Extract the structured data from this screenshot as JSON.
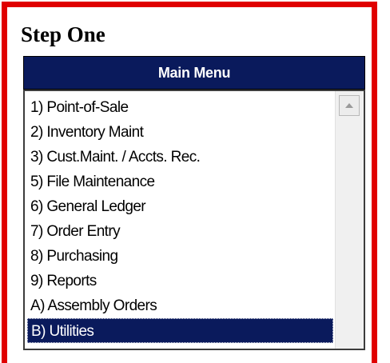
{
  "step_title": "Step One",
  "main_menu": {
    "header": "Main Menu",
    "items": [
      {
        "label": "1) Point-of-Sale"
      },
      {
        "label": "2) Inventory Maint"
      },
      {
        "label": "3) Cust.Maint. / Accts. Rec."
      },
      {
        "label": "5) File Maintenance"
      },
      {
        "label": "6) General Ledger"
      },
      {
        "label": "7) Order Entry"
      },
      {
        "label": "8) Purchasing"
      },
      {
        "label": "9) Reports"
      },
      {
        "label": "A) Assembly Orders"
      },
      {
        "label": "B) Utilities",
        "selected": true
      }
    ],
    "selected_item": "B) Utilities"
  },
  "colors": {
    "frame_border": "#e00000",
    "header_bg": "#0a1a5c",
    "selected_bg": "#0a1a5c",
    "header_text": "#ffffff"
  },
  "icons": {
    "scroll_up": "scroll-up-arrow-icon"
  }
}
